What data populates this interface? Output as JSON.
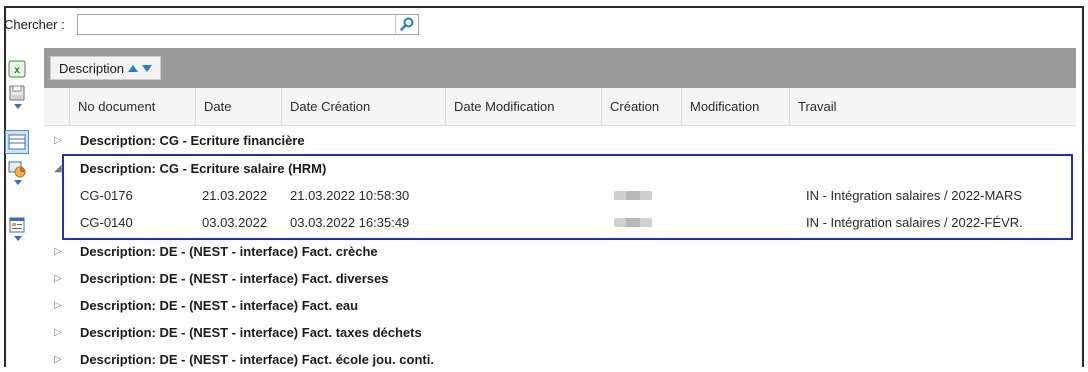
{
  "search": {
    "label": "Chercher :",
    "value": "",
    "placeholder": ""
  },
  "toolbar": {
    "icons": [
      "excel-export-icon",
      "save-icon",
      "grid-view-icon",
      "chart-icon",
      "form-view-icon"
    ]
  },
  "group_by": {
    "label": "Description"
  },
  "columns": [
    "No document",
    "Date",
    "Date Création",
    "Date Modification",
    "Création",
    "Modification",
    "Travail"
  ],
  "groups": [
    {
      "text": "Description: CG - Ecriture financière",
      "expanded": false
    },
    {
      "text": "Description: CG - Ecriture salaire (HRM)",
      "expanded": true,
      "rows": [
        {
          "no_document": "CG-0176",
          "date": "21.03.2022",
          "date_creation": "21.03.2022 10:58:30",
          "date_modification": "",
          "creation": "[blurred]",
          "modification": "",
          "travail": "IN - Intégration salaires / 2022-MARS"
        },
        {
          "no_document": "CG-0140",
          "date": "03.03.2022",
          "date_creation": "03.03.2022 16:35:49",
          "date_modification": "",
          "creation": "[blurred]",
          "modification": "",
          "travail": "IN - Intégration salaires / 2022-FÉVR."
        }
      ]
    },
    {
      "text": "Description: DE - (NEST - interface) Fact. crèche",
      "expanded": false
    },
    {
      "text": "Description: DE - (NEST - interface) Fact. diverses",
      "expanded": false
    },
    {
      "text": "Description: DE - (NEST - interface) Fact. eau",
      "expanded": false
    },
    {
      "text": "Description: DE - (NEST - interface) Fact. taxes déchets",
      "expanded": false
    },
    {
      "text": "Description: DE - (NEST - interface) Fact. école jou. conti.",
      "expanded": false
    }
  ],
  "colors": {
    "highlight": "#1f2fbf",
    "accent": "#1e7fd6",
    "group_bar": "#9a9a9a"
  }
}
